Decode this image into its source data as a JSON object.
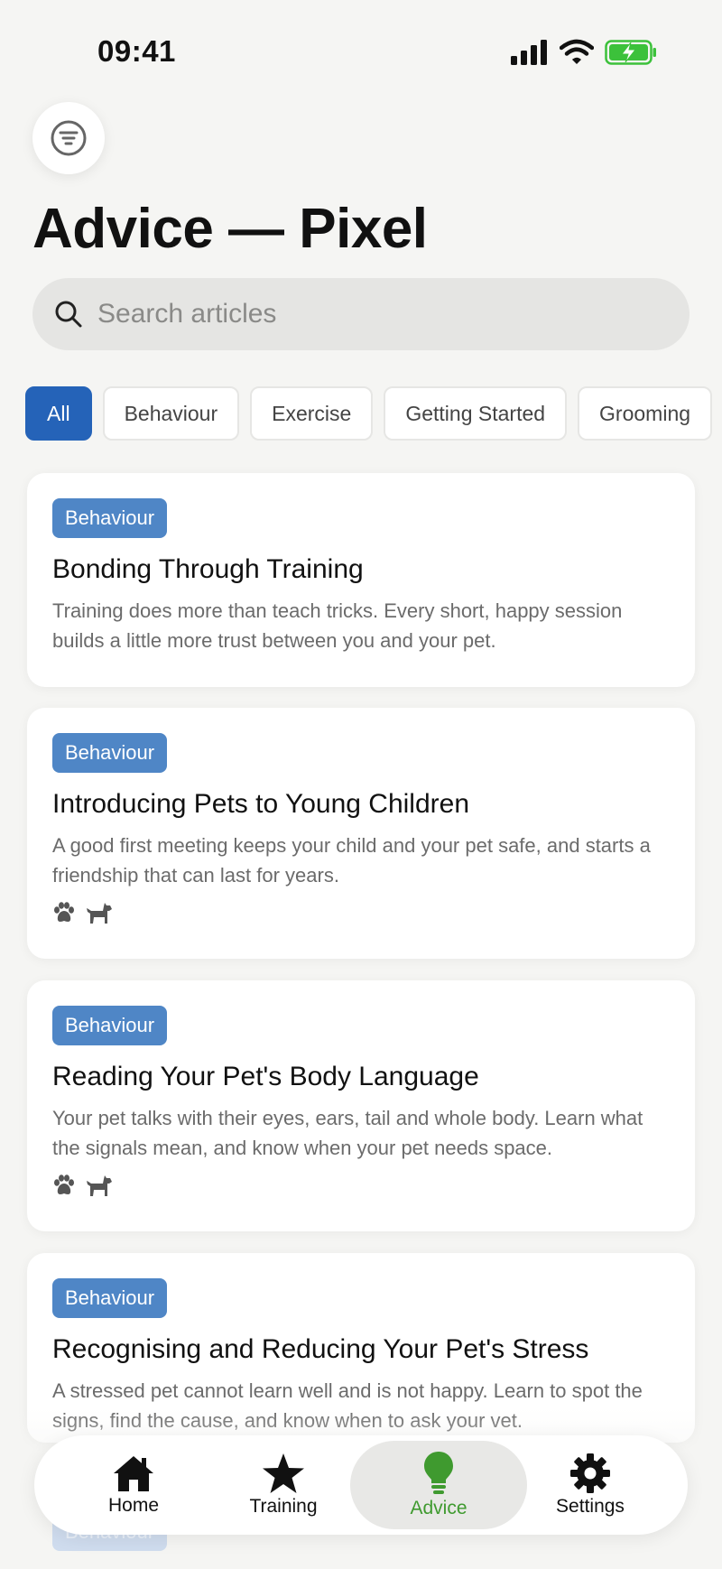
{
  "status_bar": {
    "time": "09:41"
  },
  "page": {
    "title": "Advice — Pixel"
  },
  "search": {
    "placeholder": "Search articles"
  },
  "filters": [
    "All",
    "Behaviour",
    "Exercise",
    "Getting Started",
    "Grooming"
  ],
  "active_filter": "All",
  "articles": [
    {
      "category": "Behaviour",
      "title": "Bonding Through Training",
      "description": "Training does more than teach tricks. Every short, happy session builds a little more trust between you and your pet."
    },
    {
      "category": "Behaviour",
      "title": "Introducing Pets to Young Children",
      "description": "A good first meeting keeps your child and your pet safe, and starts a friendship that can last for years.",
      "pet_icons": [
        "paw-icon",
        "dog-icon"
      ]
    },
    {
      "category": "Behaviour",
      "title": "Reading Your Pet's Body Language",
      "description": "Your pet talks with their eyes, ears, tail and whole body. Learn what the signals mean, and know when your pet needs space.",
      "pet_icons": [
        "paw-icon",
        "dog-icon"
      ]
    },
    {
      "category": "Behaviour",
      "title": "Recognising and Reducing Your Pet's Stress",
      "description": "A stressed pet cannot learn well and is not happy. Learn to spot the signs, find the cause, and know when to ask your vet."
    },
    {
      "category": "Behaviour"
    }
  ],
  "tabs": [
    {
      "label": "Home",
      "icon": "home-icon"
    },
    {
      "label": "Training",
      "icon": "star-icon"
    },
    {
      "label": "Advice",
      "icon": "lightbulb-icon",
      "active": true
    },
    {
      "label": "Settings",
      "icon": "gear-icon"
    }
  ],
  "colors": {
    "accent_blue": "#2563b8",
    "badge_blue": "#4f86c6",
    "active_tab_green": "#3f9a2f",
    "battery_green": "#3cc13b"
  }
}
